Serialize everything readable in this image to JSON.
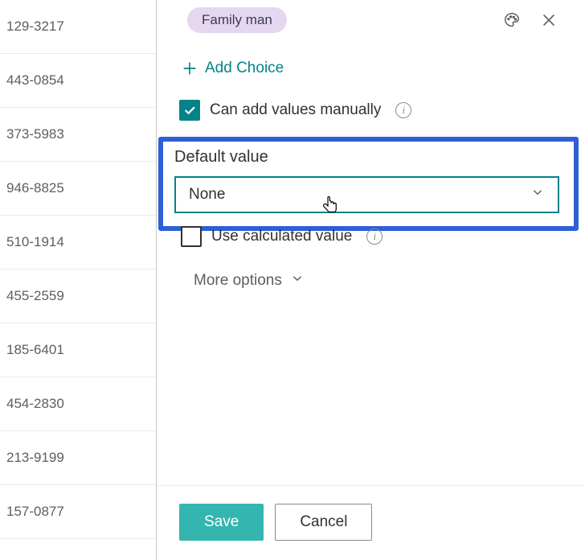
{
  "list": {
    "rows": [
      "129-3217",
      "443-0854",
      "373-5983",
      "946-8825",
      "510-1914",
      "455-2559",
      "185-6401",
      "454-2830",
      "213-9199",
      "157-0877"
    ]
  },
  "panel": {
    "choice_chip": "Family man",
    "add_choice_label": "Add Choice",
    "can_add_manually_label": "Can add values manually",
    "default_value_label": "Default value",
    "default_value_selected": "None",
    "use_calculated_label": "Use calculated value",
    "more_options_label": "More options"
  },
  "footer": {
    "save_label": "Save",
    "cancel_label": "Cancel"
  },
  "icons": {
    "palette": "palette-icon",
    "close": "close-icon",
    "plus": "plus-icon",
    "info": "info-icon",
    "chevron_down": "chevron-down-icon",
    "check": "check-icon",
    "cursor": "cursor-hand-icon"
  },
  "colors": {
    "accent": "#038387",
    "highlight_border": "#2f5fd6",
    "chip_bg": "#e6d7f0"
  }
}
